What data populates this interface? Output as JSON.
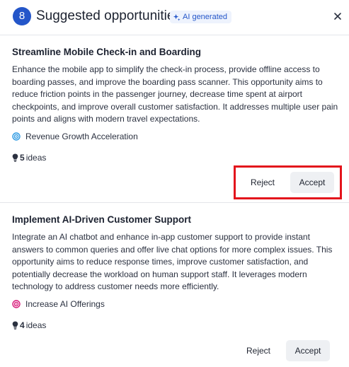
{
  "header": {
    "count": "8",
    "title": "Suggested opportunities",
    "ai_badge": "AI generated"
  },
  "colors": {
    "accent": "#2456c9",
    "highlight_border": "#e3141c",
    "tag_revenue": "#2f9be3",
    "tag_ai": "#d81b7a"
  },
  "opportunities": [
    {
      "title": "Streamline Mobile Check-in and Boarding",
      "description": "Enhance the mobile app to simplify the check-in process, provide offline access to boarding passes, and improve the boarding pass scanner. This opportunity aims to reduce friction points in the passenger journey, decrease time spent at airport checkpoints, and improve overall customer satisfaction. It addresses multiple user pain points and aligns with modern travel expectations.",
      "tag": "Revenue Growth Acceleration",
      "tag_icon": "target-icon",
      "ideas_count": "5",
      "ideas_label": "ideas",
      "reject_label": "Reject",
      "accept_label": "Accept"
    },
    {
      "title": "Implement AI-Driven Customer Support",
      "description": "Integrate an AI chatbot and enhance in-app customer support to provide instant answers to common queries and offer live chat options for more complex issues. This opportunity aims to reduce response times, improve customer satisfaction, and potentially decrease the workload on human support staff. It leverages modern technology to address customer needs more efficiently.",
      "tag": "Increase AI Offerings",
      "tag_icon": "target-icon",
      "ideas_count": "4",
      "ideas_label": "ideas",
      "reject_label": "Reject",
      "accept_label": "Accept"
    }
  ]
}
